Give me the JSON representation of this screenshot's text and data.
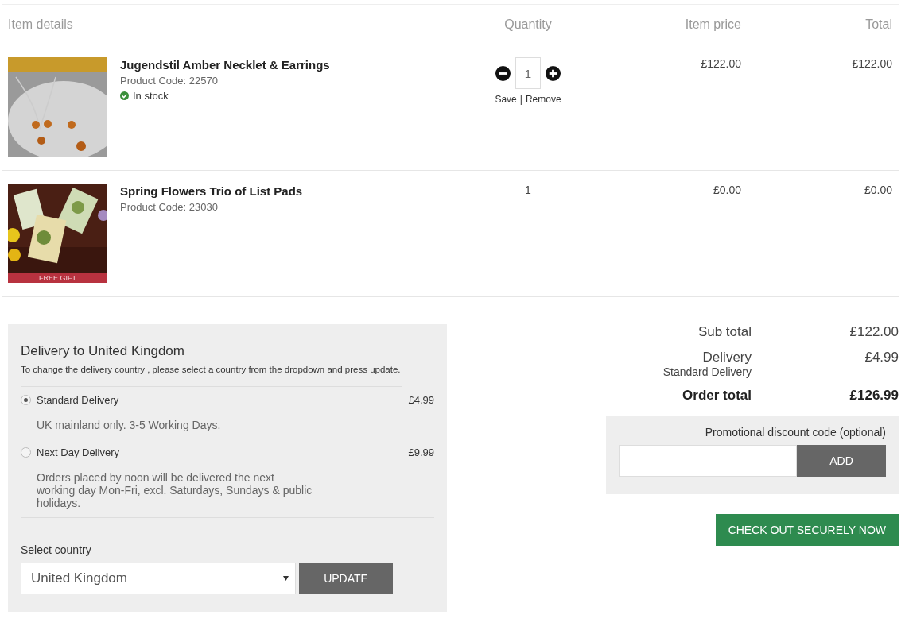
{
  "table": {
    "columns": [
      "Item details",
      "Quantity",
      "Item price",
      "Total"
    ],
    "rows": [
      {
        "name": "Jugendstil Amber Necklet & Earrings",
        "code": "Product Code: 22570",
        "stock": "In stock",
        "kind": "picture",
        "quantity": {
          "kind": "stepper",
          "value": "1",
          "actions": [
            "Save",
            "Remove"
          ],
          "separator": "|"
        },
        "price": "£122.00",
        "total": "£122.00"
      },
      {
        "name": "Spring Flowers Trio of List Pads",
        "code": "Product Code: 23030",
        "badge": "FREE GIFT",
        "kind": "picture",
        "quantity": {
          "kind": "plain",
          "value": "1"
        },
        "price": "£0.00",
        "total": "£0.00"
      }
    ]
  },
  "delivery": {
    "title": "Delivery to United Kingdom",
    "note": "To change the delivery country , please select a country from the dropdown and press update.",
    "options": [
      {
        "label": "Standard Delivery",
        "price": "£4.99",
        "selected": true,
        "description": "UK mainland only. 3-5 Working Days."
      },
      {
        "label": "Next Day Delivery",
        "price": "£9.99",
        "selected": false,
        "description": "Orders placed by noon will be delivered the next working day Mon-Fri, excl. Saturdays, Sundays & public holidays."
      }
    ],
    "country_label": "Select country",
    "country": "United Kingdom",
    "update_button": "UPDATE"
  },
  "summary": {
    "subtotal_label": "Sub total",
    "subtotal": "£122.00",
    "delivery_label": "Delivery",
    "delivery_method": "Standard Delivery",
    "delivery": "£4.99",
    "order_total_label": "Order total",
    "order_total": "£126.99"
  },
  "promo": {
    "label": "Promotional discount code (optional)",
    "button": "ADD"
  },
  "checkout_button": "CHECK OUT SECURELY NOW"
}
